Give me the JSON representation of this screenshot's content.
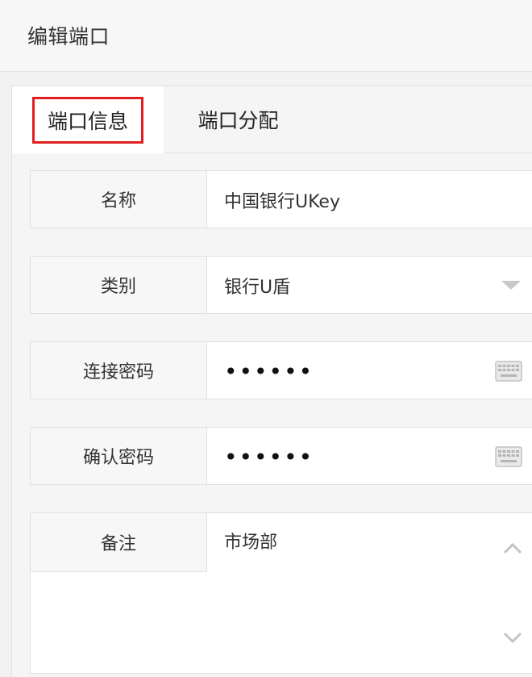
{
  "header": {
    "title": "编辑端口"
  },
  "tabs": [
    {
      "label": "端口信息",
      "active": true
    },
    {
      "label": "端口分配",
      "active": false
    }
  ],
  "form": {
    "name": {
      "label": "名称",
      "value": "中国银行UKey"
    },
    "category": {
      "label": "类别",
      "value": "银行U盾"
    },
    "connect_password": {
      "label": "连接密码",
      "value": "••••••"
    },
    "confirm_password": {
      "label": "确认密码",
      "value": "••••••"
    },
    "remark": {
      "label": "备注",
      "value": "市场部"
    }
  },
  "icons": {
    "dropdown": "chevron-down-icon",
    "keyboard": "keyboard-icon",
    "scroll_up": "chevron-up-icon",
    "scroll_down": "chevron-down-icon"
  },
  "colors": {
    "highlight_border": "#e02020",
    "label_bg": "#f7f7f7",
    "page_bg": "#f2f2f2"
  }
}
